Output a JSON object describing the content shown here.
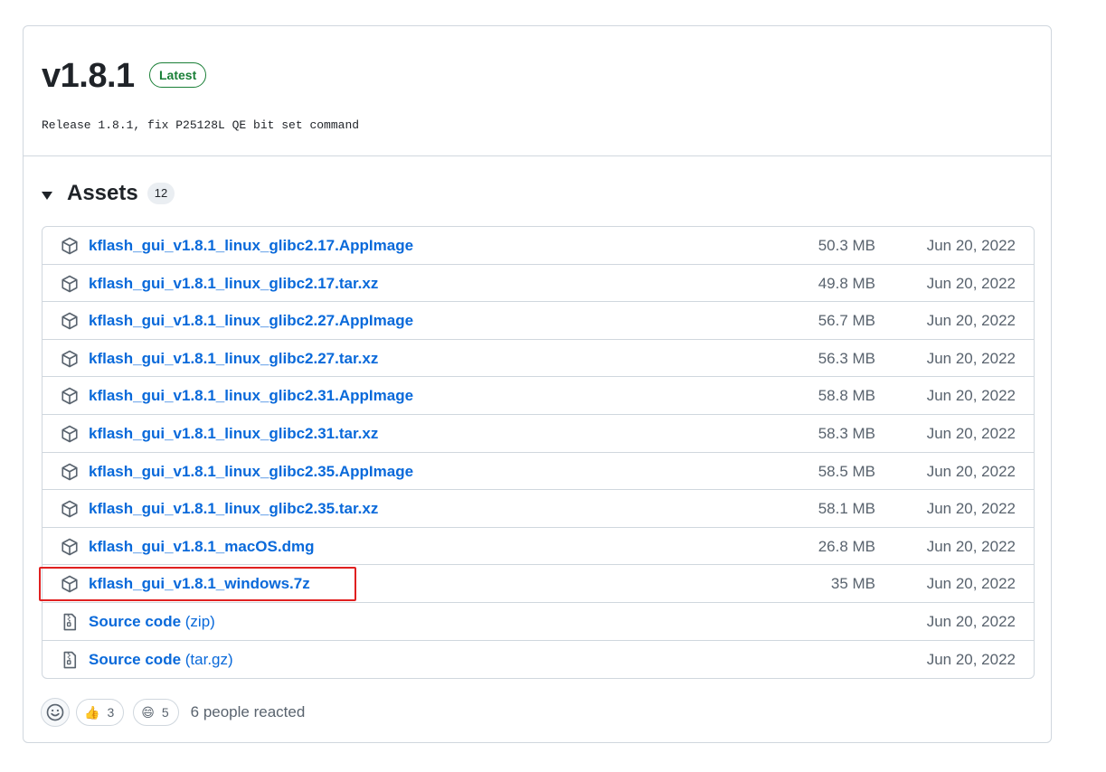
{
  "release": {
    "title": "v1.8.1",
    "badge": "Latest",
    "notes": "Release 1.8.1, fix P25128L QE bit set command"
  },
  "assets": {
    "label": "Assets",
    "count": "12",
    "items": [
      {
        "name": "kflash_gui_v1.8.1_linux_glibc2.17.AppImage",
        "suffix": "",
        "size": "50.3 MB",
        "date": "Jun 20, 2022",
        "icon": "package-icon"
      },
      {
        "name": "kflash_gui_v1.8.1_linux_glibc2.17.tar.xz",
        "suffix": "",
        "size": "49.8 MB",
        "date": "Jun 20, 2022",
        "icon": "package-icon"
      },
      {
        "name": "kflash_gui_v1.8.1_linux_glibc2.27.AppImage",
        "suffix": "",
        "size": "56.7 MB",
        "date": "Jun 20, 2022",
        "icon": "package-icon"
      },
      {
        "name": "kflash_gui_v1.8.1_linux_glibc2.27.tar.xz",
        "suffix": "",
        "size": "56.3 MB",
        "date": "Jun 20, 2022",
        "icon": "package-icon"
      },
      {
        "name": "kflash_gui_v1.8.1_linux_glibc2.31.AppImage",
        "suffix": "",
        "size": "58.8 MB",
        "date": "Jun 20, 2022",
        "icon": "package-icon"
      },
      {
        "name": "kflash_gui_v1.8.1_linux_glibc2.31.tar.xz",
        "suffix": "",
        "size": "58.3 MB",
        "date": "Jun 20, 2022",
        "icon": "package-icon"
      },
      {
        "name": "kflash_gui_v1.8.1_linux_glibc2.35.AppImage",
        "suffix": "",
        "size": "58.5 MB",
        "date": "Jun 20, 2022",
        "icon": "package-icon"
      },
      {
        "name": "kflash_gui_v1.8.1_linux_glibc2.35.tar.xz",
        "suffix": "",
        "size": "58.1 MB",
        "date": "Jun 20, 2022",
        "icon": "package-icon"
      },
      {
        "name": "kflash_gui_v1.8.1_macOS.dmg",
        "suffix": "",
        "size": "26.8 MB",
        "date": "Jun 20, 2022",
        "icon": "package-icon"
      },
      {
        "name": "kflash_gui_v1.8.1_windows.7z",
        "suffix": "",
        "size": "35 MB",
        "date": "Jun 20, 2022",
        "icon": "package-icon"
      },
      {
        "name": "Source code",
        "suffix": " (zip)",
        "size": "",
        "date": "Jun 20, 2022",
        "icon": "file-zip-icon"
      },
      {
        "name": "Source code",
        "suffix": " (tar.gz)",
        "size": "",
        "date": "Jun 20, 2022",
        "icon": "file-zip-icon"
      }
    ]
  },
  "reactions": {
    "items": [
      {
        "emoji": "👍",
        "count": "3",
        "icon": "thumbs-up-icon"
      },
      {
        "emoji": "😄",
        "count": "5",
        "icon": "smile-icon"
      }
    ],
    "summary": "6 people reacted"
  },
  "colors": {
    "link": "#0969da",
    "latest": "#1a7f37",
    "highlight": "#e02020"
  }
}
